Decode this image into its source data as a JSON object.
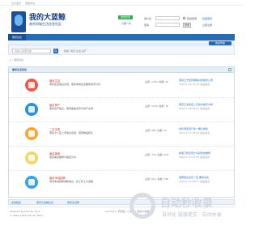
{
  "topbar": {
    "items": [
      "设为首页",
      "收藏本站"
    ]
  },
  "header": {
    "title": "我的大蓝鲸",
    "subtitle": "南京同城生活信息社区",
    "wechat_label": "微信登录",
    "wechat_sub": "只需一步",
    "login": {
      "user_label": "用户名",
      "pass_label": "密码",
      "remember_label": "自动登录",
      "forgot_label": "找回密码",
      "register_label": "立即注册",
      "login_button": "登录"
    }
  },
  "nav": {
    "active_tab": "南京论坛",
    "quick_nav": "快捷导航"
  },
  "search": {
    "placeholder": "请输入搜索内容",
    "hot_label": "热搜: 南京 生活 房产"
  },
  "breadcrumb": "⌂ › 南京论坛",
  "section": {
    "title": "南京生活论坛"
  },
  "forums": [
    {
      "title": "南京生活",
      "desc": "南京生活信息交流，南京本地生活服务资讯分享",
      "stat": "主题: 1432, 帖数: 2k",
      "last": "南京江宁区有哪些好的装修公司",
      "last_meta": "2022-1-20 12:16 最后发表",
      "color": "#e85b4c"
    },
    {
      "title": "南京房产",
      "desc": "南京房产信息，南京楼盘资讯与房产交流",
      "stat": "主题: 1203, 帖数: 1k",
      "last": "南京江北新区二手房价格怎么样",
      "last_meta": "2022-1-18 09:31 最后发表",
      "color": "#2f8fd6"
    },
    {
      "title": "二手交易",
      "desc": "南京十八区二手信息交易，闲置物品转让",
      "stat": "主题: 986, 帖数: 1k",
      "last": "出售闲置自行车一辆九成新",
      "last_meta": "2022-1-17 16:05 最后发表",
      "color": "#f0a93b"
    },
    {
      "title": "南京美食",
      "desc": "南京美食推荐与探店分享",
      "stat": "主题: 754, 帖数: 903",
      "last": "新街口附近有什么好吃的推荐",
      "last_meta": "2022-1-15 11:42 最后发表",
      "color": "#f3d66a"
    },
    {
      "title": "南京本地招聘",
      "desc": "南京本地招聘求职信息，找工作上大蓝鲸",
      "stat": "主题: 612, 帖数: 780",
      "last": "招聘前台文员一名 要求女性",
      "last_meta": "2022-1-12 08:57 最后发表",
      "color": "#3fa0e0"
    }
  ],
  "links": {
    "items": [
      "友情链接",
      "南京大蓝鲸论坛",
      "南京生活网"
    ]
  },
  "footer": {
    "powered": "Powered by Discuz! X3.4",
    "copyright": "© 2001-2022 Discuz! Team.",
    "links": [
      "Archiver",
      "手机版",
      "小黑屋",
      "我的大蓝鲸"
    ]
  },
  "watermark": {
    "main": "自动秒收录",
    "sub": "自动化 链接提交 · 自动收录"
  }
}
